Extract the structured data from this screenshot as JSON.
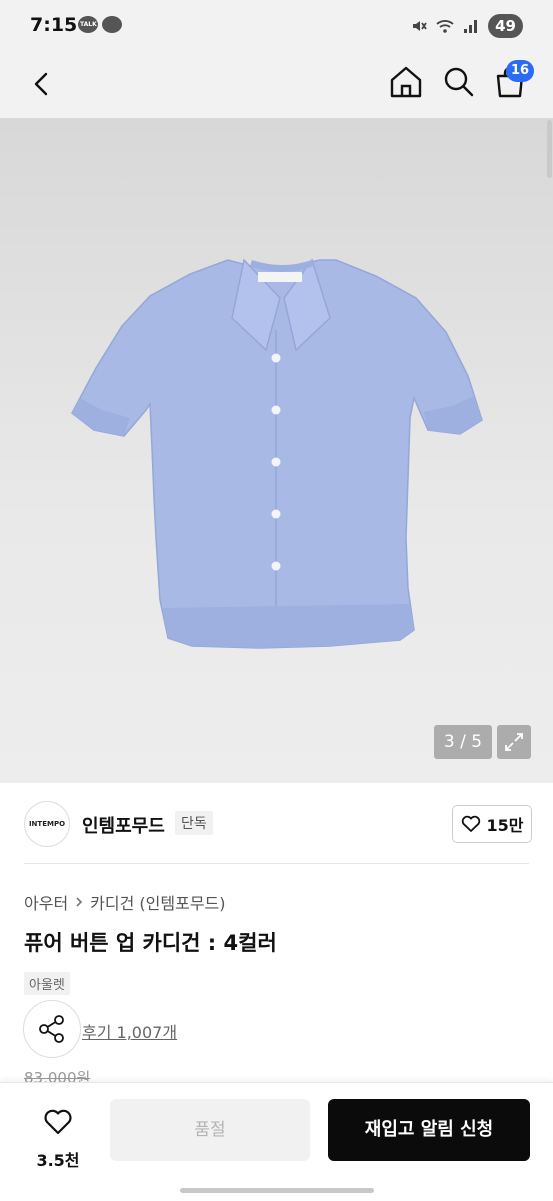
{
  "status_bar": {
    "time": "7:15",
    "battery": "49"
  },
  "header": {
    "cart_count": "16"
  },
  "gallery": {
    "counter": "3 / 5",
    "shirt_color": "#a9b9e6"
  },
  "brand": {
    "logo_text": "INTEMPO",
    "name": "인템포무드",
    "tag": "단독",
    "likes": "15만"
  },
  "product": {
    "breadcrumb": [
      "아우터",
      "카디건 (인템포무드)"
    ],
    "title": "퓨어 버튼 업 카디건 : 4컬러",
    "outlet_tag": "아울렛",
    "reviews": "후기 1,007개",
    "original_price": "83,000원"
  },
  "bottom_bar": {
    "wish_count": "3.5천",
    "soldout_label": "품절",
    "restock_label": "재입고 알림 신청"
  },
  "colors": {
    "accent": "#2b6cf6",
    "dark_button": "#0b0b0b"
  }
}
